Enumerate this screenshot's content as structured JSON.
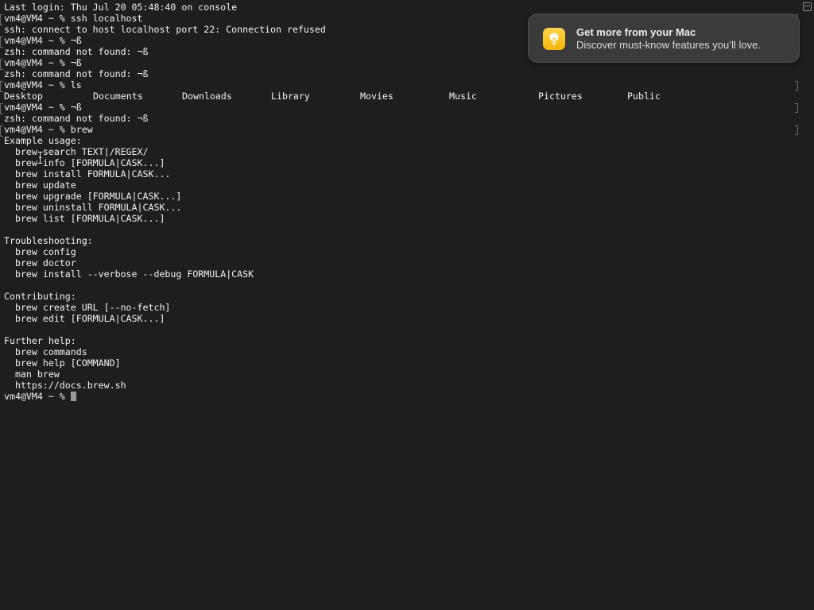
{
  "terminal": {
    "lines": [
      "Last login: Thu Jul 20 05:48:40 on console",
      "vm4@VM4 ~ % ssh localhost",
      "ssh: connect to host localhost port 22: Connection refused",
      "vm4@VM4 ~ % ¬ß",
      "zsh: command not found: ¬ß",
      "vm4@VM4 ~ % ¬ß",
      "zsh: command not found: ¬ß",
      "vm4@VM4 ~ % ls"
    ],
    "ls_output": [
      "Desktop",
      "Documents",
      "Downloads",
      "Library",
      "Movies",
      "Music",
      "Pictures",
      "Public"
    ],
    "lines_after_ls": [
      "vm4@VM4 ~ % ¬ß",
      "zsh: command not found: ¬ß",
      "vm4@VM4 ~ % brew",
      "Example usage:",
      "  brew search TEXT|/REGEX/",
      "  brew info [FORMULA|CASK...]",
      "  brew install FORMULA|CASK...",
      "  brew update",
      "  brew upgrade [FORMULA|CASK...]",
      "  brew uninstall FORMULA|CASK...",
      "  brew list [FORMULA|CASK...]",
      "",
      "Troubleshooting:",
      "  brew config",
      "  brew doctor",
      "  brew install --verbose --debug FORMULA|CASK",
      "",
      "Contributing:",
      "  brew create URL [--no-fetch]",
      "  brew edit [FORMULA|CASK...]",
      "",
      "Further help:",
      "  brew commands",
      "  brew help [COMMAND]",
      "  man brew",
      "  https://docs.brew.sh"
    ],
    "current_prompt": "vm4@VM4 ~ % "
  },
  "notification": {
    "title": "Get more from your Mac",
    "body": "Discover must-know features you’ll love.",
    "icon": "lightbulb-icon",
    "icon_color": "#f5b50a"
  },
  "colors": {
    "background": "#1e1e1e",
    "foreground": "#f2f2f2",
    "cursor": "#9a9a9a"
  }
}
